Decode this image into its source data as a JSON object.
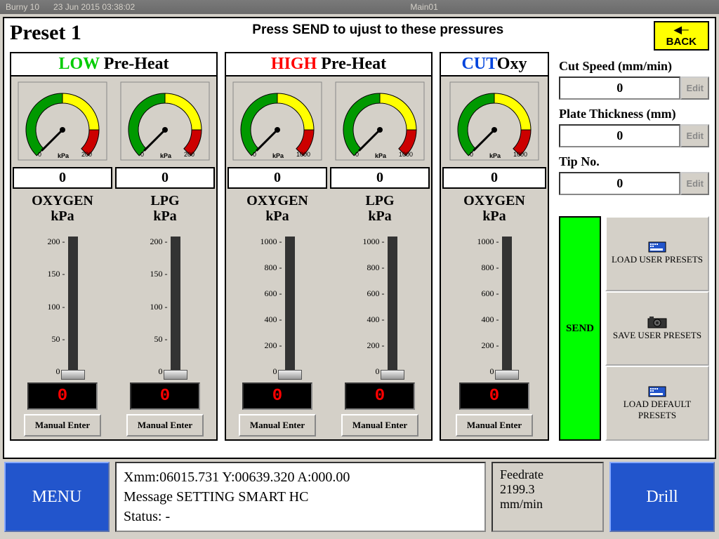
{
  "titlebar": {
    "app": "Burny 10",
    "datetime": "23 Jun 2015 03:38:02",
    "screen": "Main01"
  },
  "header": {
    "preset": "Preset 1",
    "instruction": "Press SEND to ujust to these pressures",
    "back": "BACK"
  },
  "groups": {
    "low": {
      "prefix": "LOW",
      "suffix": " Pre-Heat"
    },
    "high": {
      "prefix": "HIGH",
      "suffix": " Pre-Heat"
    },
    "cut": {
      "prefix": "CUT",
      "suffix": "Oxy"
    }
  },
  "gauge": {
    "min": "0",
    "low_max": "200",
    "high_max": "1000",
    "unit": "kPa"
  },
  "channels": {
    "low_oxy": {
      "readout": "0",
      "name": "OXYGEN",
      "unit": "kPa",
      "ticks": [
        "200 -",
        "150 -",
        "100 -",
        "50 -",
        "0 -"
      ],
      "digital": "0",
      "manual": "Manual Enter"
    },
    "low_lpg": {
      "readout": "0",
      "name": "LPG",
      "unit": "kPa",
      "ticks": [
        "200 -",
        "150 -",
        "100 -",
        "50 -",
        "0 -"
      ],
      "digital": "0",
      "manual": "Manual Enter"
    },
    "high_oxy": {
      "readout": "0",
      "name": "OXYGEN",
      "unit": "kPa",
      "ticks": [
        "1000 -",
        "800 -",
        "600 -",
        "400 -",
        "200 -",
        "0 -"
      ],
      "digital": "0",
      "manual": "Manual Enter"
    },
    "high_lpg": {
      "readout": "0",
      "name": "LPG",
      "unit": "kPa",
      "ticks": [
        "1000 -",
        "800 -",
        "600 -",
        "400 -",
        "200 -",
        "0 -"
      ],
      "digital": "0",
      "manual": "Manual Enter"
    },
    "cut_oxy": {
      "readout": "0",
      "name": "OXYGEN",
      "unit": "kPa",
      "ticks": [
        "1000 -",
        "800 -",
        "600 -",
        "400 -",
        "200 -",
        "0 -"
      ],
      "digital": "0",
      "manual": "Manual Enter"
    }
  },
  "params": {
    "cutspeed": {
      "label": "Cut Speed (mm/min)",
      "value": "0",
      "edit": "Edit"
    },
    "plate": {
      "label": "Plate Thickness (mm)",
      "value": "0",
      "edit": "Edit"
    },
    "tip": {
      "label": "Tip No.",
      "value": "0",
      "edit": "Edit"
    }
  },
  "actions": {
    "send": "SEND",
    "load_user": "LOAD USER PRESETS",
    "save_user": "SAVE USER PRESETS",
    "load_default": "LOAD DEFAULT PRESETS"
  },
  "bottom": {
    "menu": "MENU",
    "status_line1": "Xmm:06015.731 Y:00639.320 A:000.00",
    "status_line2": "Message SETTING SMART HC",
    "status_line3": "Status:  -",
    "feedrate_label": "Feedrate",
    "feedrate_value": "2199.3",
    "feedrate_unit": "mm/min",
    "drill": "Drill"
  }
}
